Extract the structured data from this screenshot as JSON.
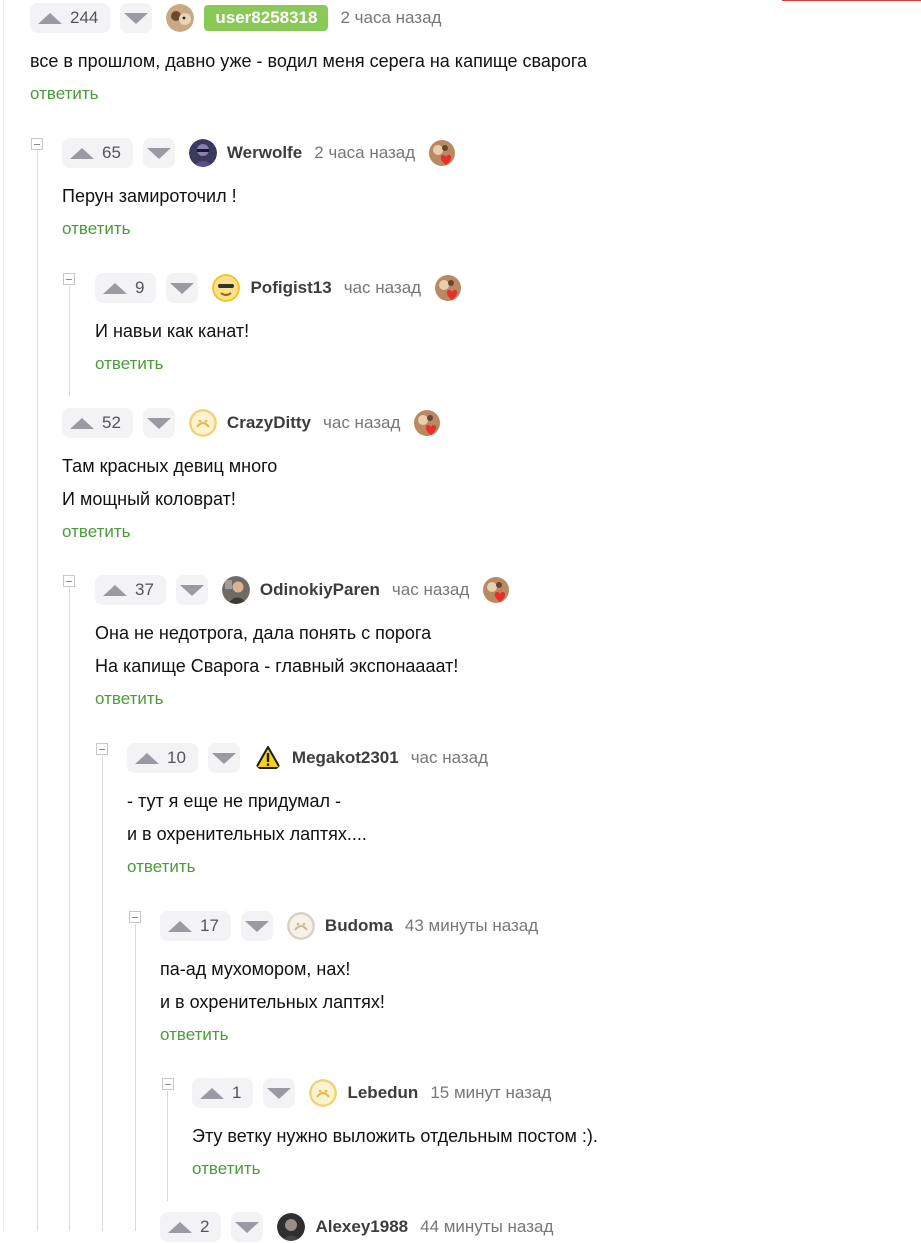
{
  "reply_label": "ответить",
  "colors": {
    "accent_green": "#4c9b3a",
    "badge_green": "#8ac858",
    "vote_bg": "#f3f3f6"
  },
  "comments": [
    {
      "score": "244",
      "user": "user8258318",
      "time": "2 часа назад",
      "avatar": "dog-photo-avatar",
      "highlight_user": true,
      "badge": false,
      "lines": [
        "все в прошлом, давно уже - водил меня серега на капище сварога"
      ]
    },
    {
      "score": "65",
      "user": "Werwolfe",
      "time": "2 часа назад",
      "avatar": "dark-portrait-avatar",
      "badge": true,
      "lines": [
        "Перун замироточил !"
      ]
    },
    {
      "score": "9",
      "user": "Pofigist13",
      "time": "час назад",
      "avatar": "cartoon-face-avatar",
      "badge": true,
      "lines": [
        "И навьи как канат!"
      ]
    },
    {
      "score": "52",
      "user": "CrazyDitty",
      "time": "час назад",
      "avatar": "default-avatar",
      "badge": true,
      "lines": [
        "Там красных девиц много",
        "И мощный коловрат!"
      ]
    },
    {
      "score": "37",
      "user": "OdinokiyParen",
      "time": "час назад",
      "avatar": "person-photo-avatar",
      "badge": true,
      "lines": [
        "Она не недотрога, дала понять с порога",
        "На капище Сварога - главный экспонаааат!"
      ]
    },
    {
      "score": "10",
      "user": "Megakot2301",
      "time": "час назад",
      "avatar": "warning-sign-avatar",
      "badge": false,
      "lines": [
        "- тут я еще не придумал -",
        "и в охренительных лаптях...."
      ]
    },
    {
      "score": "17",
      "user": "Budoma",
      "time": "43 минуты назад",
      "avatar": "default-avatar",
      "badge": false,
      "lines": [
        "па-ад мухомором, нах!",
        "и в охренительных лаптях!"
      ]
    },
    {
      "score": "1",
      "user": "Lebedun",
      "time": "15 минут назад",
      "avatar": "default-avatar",
      "badge": false,
      "lines": [
        "Эту ветку нужно выложить отдельным постом :)."
      ]
    },
    {
      "score": "2",
      "user": "Alexey1988",
      "time": "44 минуты назад",
      "avatar": "dark-portrait-avatar",
      "badge": false,
      "lines": []
    }
  ]
}
